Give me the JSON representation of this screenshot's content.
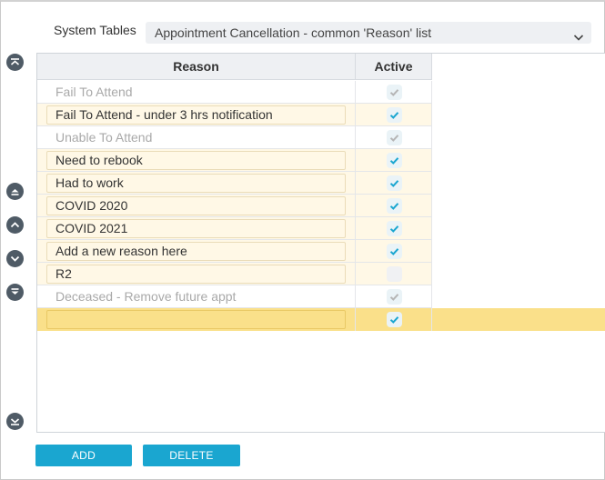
{
  "header": {
    "system_tables_label": "System Tables",
    "selected_table": "Appointment Cancellation - common 'Reason' list"
  },
  "columns": {
    "reason": "Reason",
    "active": "Active"
  },
  "rows": [
    {
      "reason": "Fail To Attend",
      "active": true,
      "editable": false
    },
    {
      "reason": "Fail To Attend - under 3 hrs notification",
      "active": true,
      "editable": true
    },
    {
      "reason": "Unable To Attend",
      "active": true,
      "editable": false
    },
    {
      "reason": "Need to rebook",
      "active": true,
      "editable": true
    },
    {
      "reason": "Had to work",
      "active": true,
      "editable": true
    },
    {
      "reason": "COVID 2020",
      "active": true,
      "editable": true
    },
    {
      "reason": "COVID 2021",
      "active": true,
      "editable": true
    },
    {
      "reason": "Add a new reason here",
      "active": true,
      "editable": true
    },
    {
      "reason": "R2",
      "active": false,
      "editable": true
    },
    {
      "reason": "Deceased - Remove future appt",
      "active": true,
      "editable": false
    },
    {
      "reason": "",
      "active": true,
      "editable": true,
      "selected": true
    }
  ],
  "buttons": {
    "add": "ADD",
    "delete": "DELETE"
  },
  "colors": {
    "accent": "#1aa6d0",
    "check": "#1aa6d0",
    "check_disabled": "#b5b5b5",
    "selected_row": "#fae08a",
    "editable_row": "#fff8e6",
    "side_button": "#4f5b66"
  },
  "icons": {
    "dropdown": "chevron-down-icon",
    "move_first": "move-to-top-icon",
    "move_eject": "eject-up-icon",
    "move_up": "chevron-up-icon",
    "move_down": "chevron-down-icon",
    "move_down_alt": "eject-down-icon",
    "move_last": "move-to-bottom-icon",
    "check": "check-icon"
  }
}
